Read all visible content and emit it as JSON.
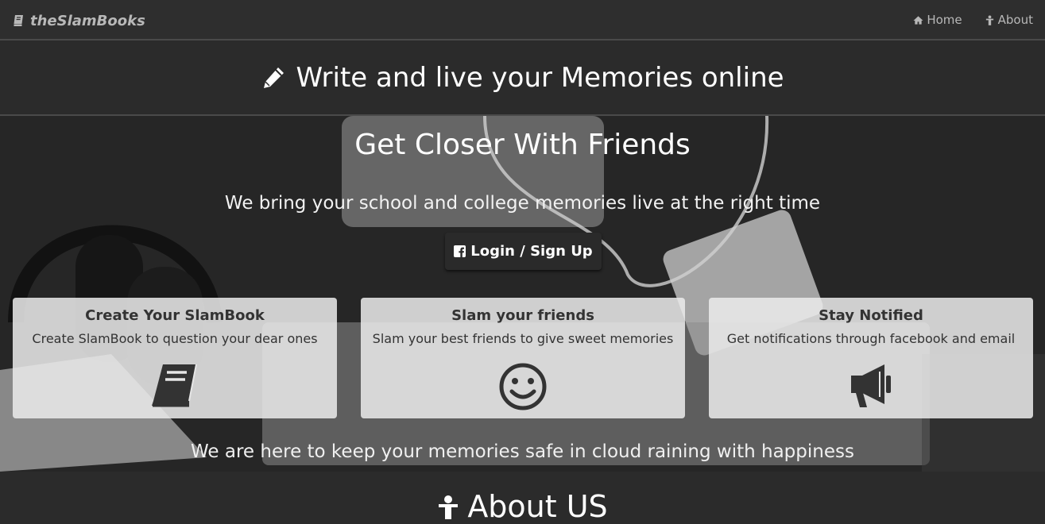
{
  "navbar": {
    "brand": "theSlamBooks",
    "brand_icon": "book-icon",
    "links": [
      {
        "label": "Home",
        "icon": "home-icon"
      },
      {
        "label": "About",
        "icon": "person-icon"
      }
    ]
  },
  "tagline": {
    "text": "Write and live your Memories online",
    "icon": "pencil-icon"
  },
  "hero": {
    "title": "Get Closer With Friends",
    "subtitle": "We bring your school and college memories live at the right time",
    "cta": {
      "label": "Login / Sign Up",
      "icon": "facebook-icon"
    },
    "cards": [
      {
        "title": "Create Your SlamBook",
        "text": "Create SlamBook to question your dear ones",
        "icon": "book-icon"
      },
      {
        "title": "Slam your friends",
        "text": "Slam your best friends to give sweet memories",
        "icon": "smile-icon"
      },
      {
        "title": "Stay Notified",
        "text": "Get notifications through facebook and email",
        "icon": "megaphone-icon"
      }
    ],
    "footer": "We are here to keep your memories safe in cloud raining with happiness"
  },
  "about": {
    "title": "About US",
    "icon": "person-icon"
  },
  "colors": {
    "navbar": "#2e2e2e",
    "page": "#2b2b2b",
    "card": "#ebebeb",
    "text": "#ffffff"
  }
}
